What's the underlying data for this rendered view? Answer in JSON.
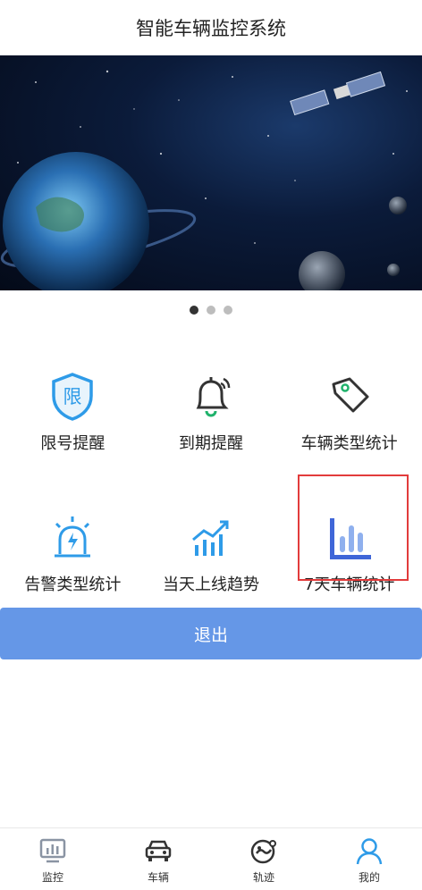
{
  "header": {
    "title": "智能车辆监控系统"
  },
  "banner": {
    "slides": 3,
    "active_index": 0
  },
  "menu": [
    {
      "label": "限号提醒",
      "icon": "shield-limit-icon"
    },
    {
      "label": "到期提醒",
      "icon": "bell-icon"
    },
    {
      "label": "车辆类型统计",
      "icon": "tag-icon"
    },
    {
      "label": "告警类型统计",
      "icon": "alarm-light-icon"
    },
    {
      "label": "当天上线趋势",
      "icon": "trend-chart-icon"
    },
    {
      "label": "7天车辆统计",
      "icon": "bar-chart-icon"
    }
  ],
  "actions": {
    "logout_label": "退出"
  },
  "tabbar": [
    {
      "label": "监控",
      "icon": "monitor-icon"
    },
    {
      "label": "车辆",
      "icon": "car-icon"
    },
    {
      "label": "轨迹",
      "icon": "track-icon"
    },
    {
      "label": "我的",
      "icon": "user-icon",
      "active": true
    }
  ],
  "colors": {
    "accent": "#6597e7",
    "icon_blue": "#2e9be8",
    "highlight_border": "#e23b3b"
  }
}
